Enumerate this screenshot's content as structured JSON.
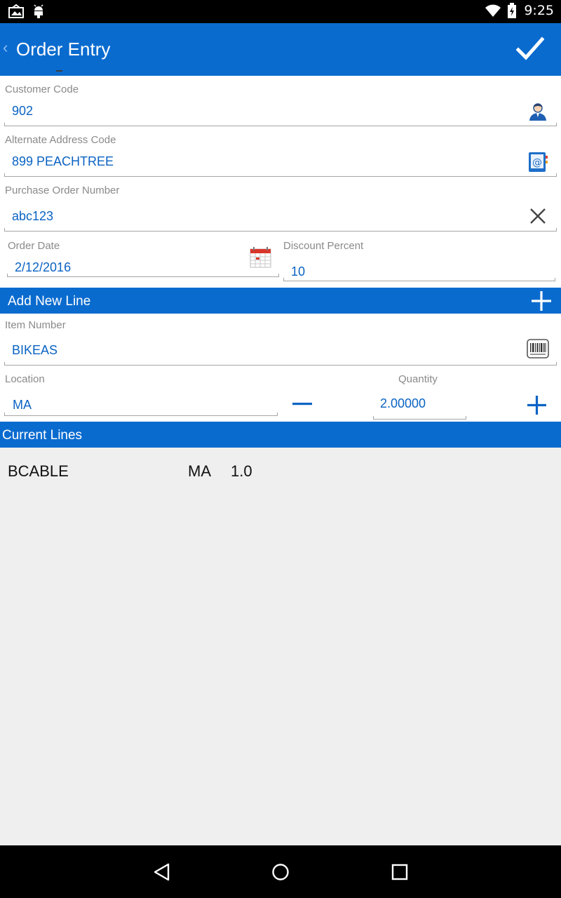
{
  "status_bar": {
    "time": "9:25"
  },
  "app_bar": {
    "title": "Order Entry",
    "back_icon": "chevron-left-icon",
    "confirm_icon": "check-icon"
  },
  "form": {
    "customer_code": {
      "label": "Customer Code",
      "value": "902",
      "icon": "customer-lookup-icon"
    },
    "alt_address": {
      "label": "Alternate Address Code",
      "value": "899 PEACHTREE",
      "icon": "address-book-icon"
    },
    "po_number": {
      "label": "Purchase Order Number",
      "value": "abc123",
      "icon": "clear-icon"
    },
    "order_date": {
      "label": "Order Date",
      "value": "2/12/2016",
      "icon": "calendar-icon"
    },
    "discount": {
      "label": "Discount Percent",
      "value": "10"
    }
  },
  "add_line": {
    "header": "Add New Line",
    "item_number": {
      "label": "Item Number",
      "value": "BIKEAS",
      "icon": "barcode-icon"
    },
    "location": {
      "label": "Location",
      "value": "MA"
    },
    "quantity": {
      "label": "Quantity",
      "value": "2.00000"
    }
  },
  "current_lines": {
    "header": "Current Lines",
    "rows": [
      {
        "item": "BCABLE",
        "location": "MA",
        "quantity": "1.0"
      }
    ]
  },
  "colors": {
    "accent": "#0a6bcf",
    "value_text": "#0a63c4"
  }
}
